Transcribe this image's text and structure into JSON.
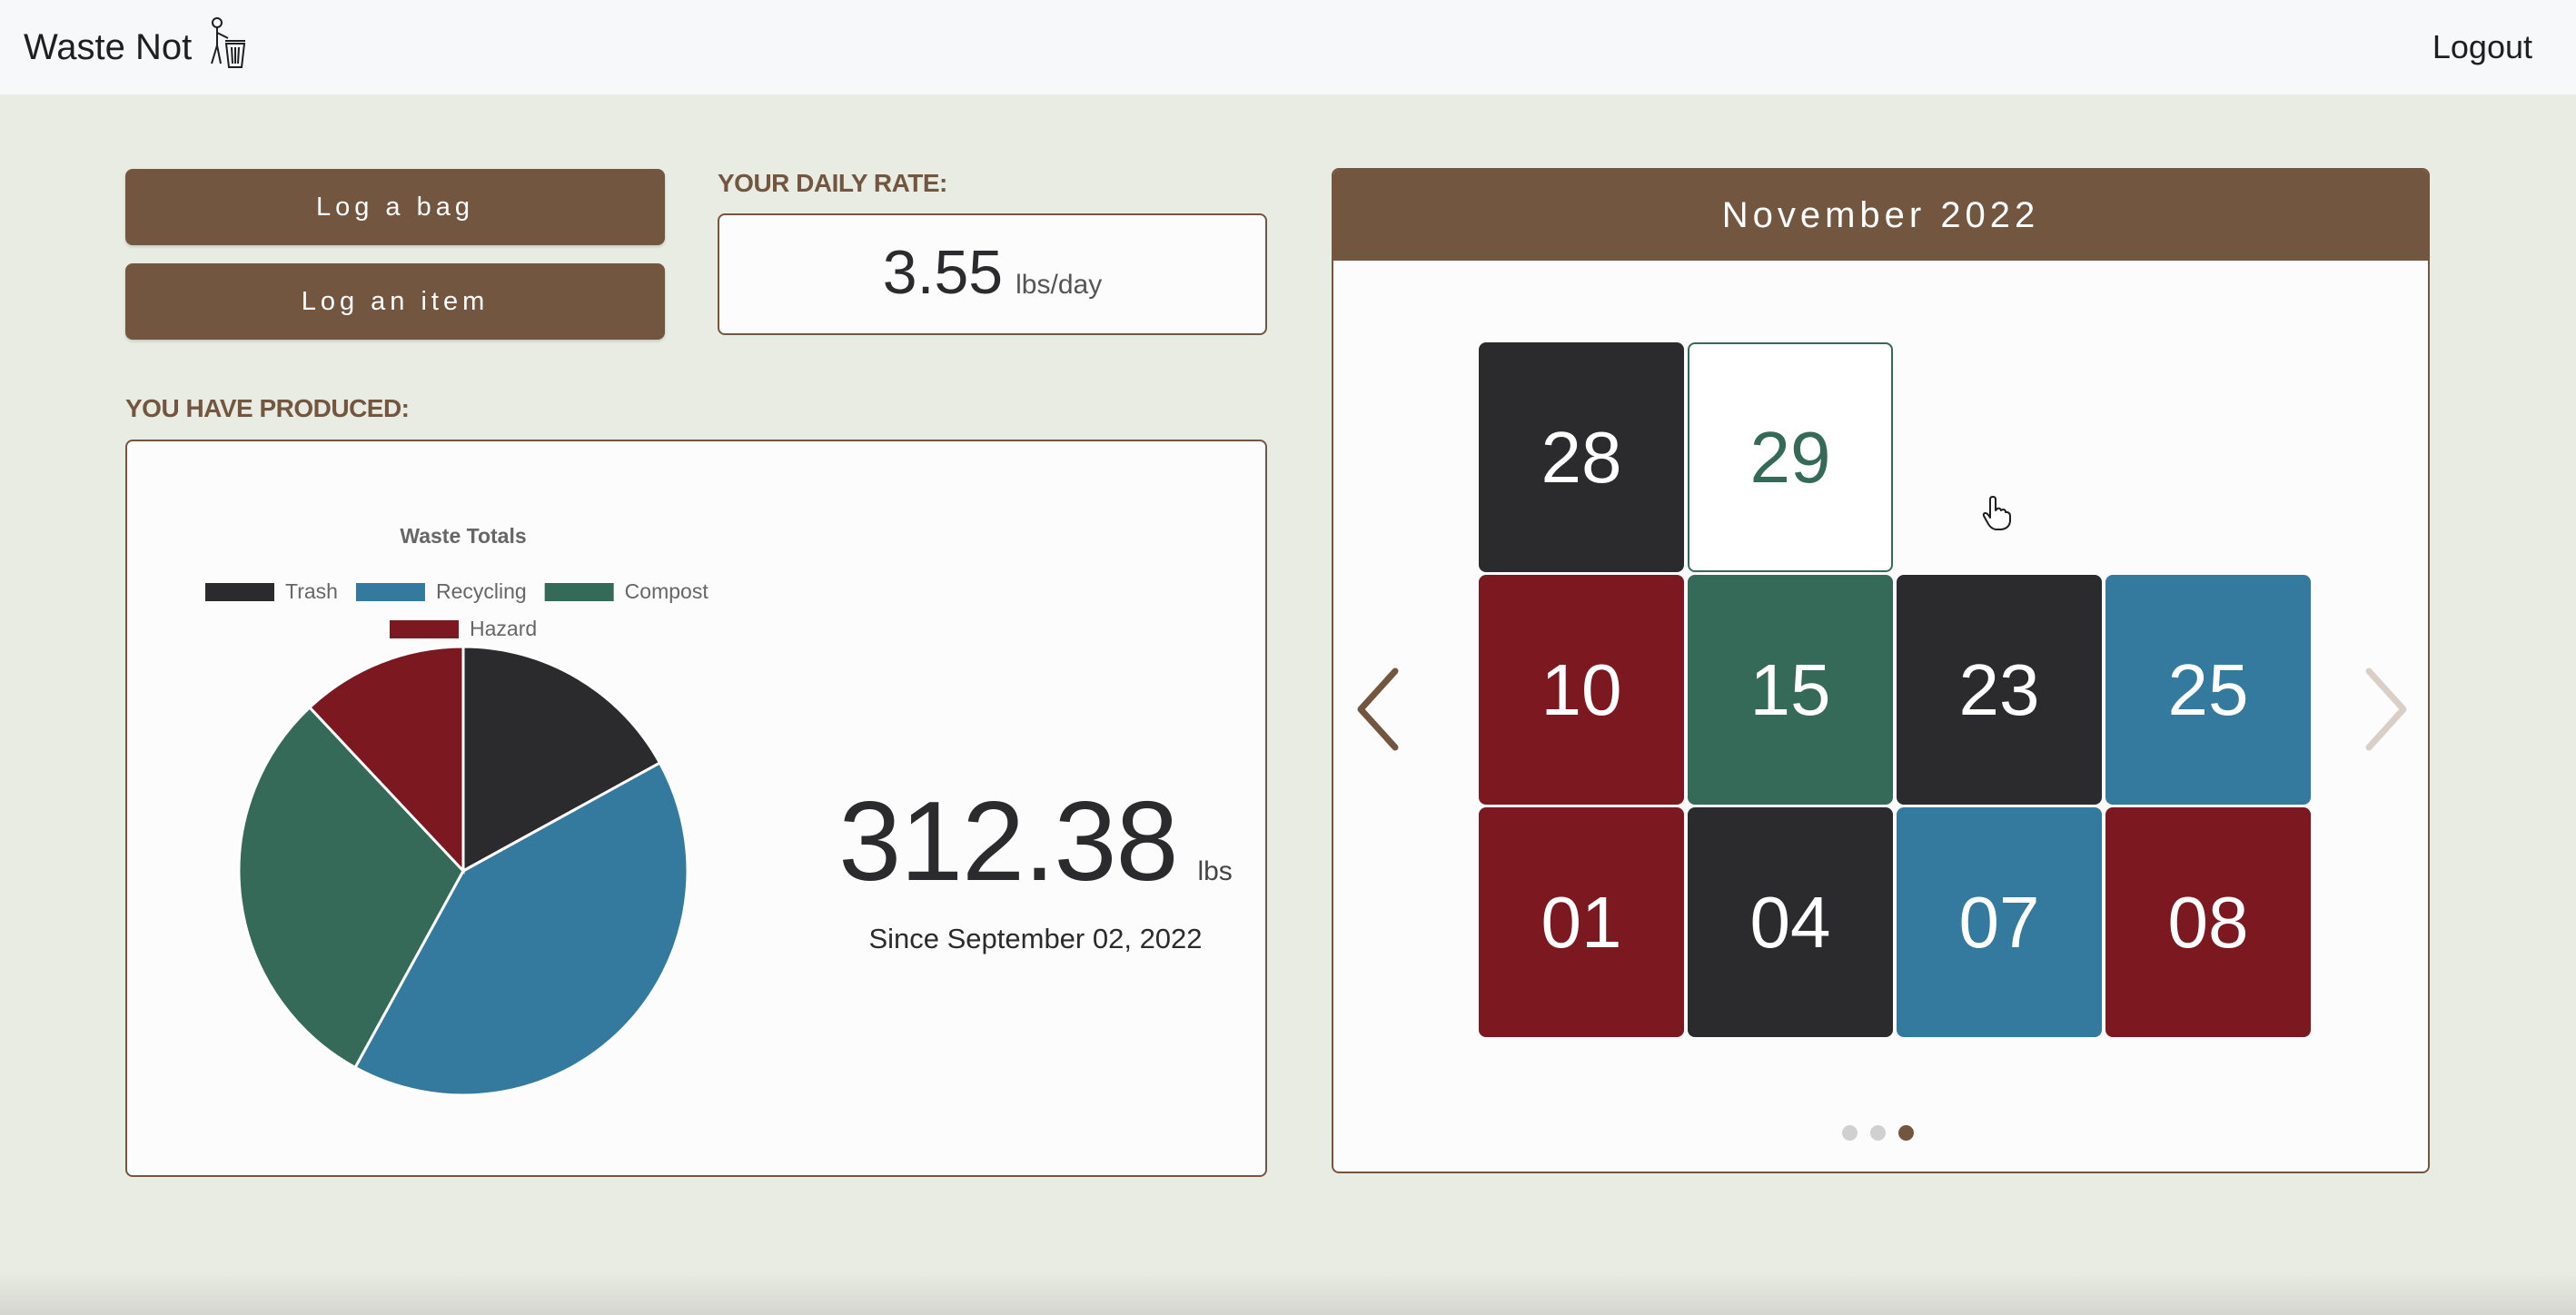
{
  "app": {
    "title": "Waste Not",
    "logout_label": "Logout"
  },
  "actions": {
    "log_bag_label": "Log a bag",
    "log_item_label": "Log an item"
  },
  "daily_rate": {
    "label": "YOUR DAILY RATE:",
    "value": "3.55",
    "unit": "lbs/day"
  },
  "produced": {
    "label": "YOU HAVE PRODUCED:",
    "total": "312.38",
    "unit": "lbs",
    "since": "Since September 02, 2022"
  },
  "chart_data": {
    "type": "pie",
    "title": "Waste Totals",
    "categories": [
      "Trash",
      "Recycling",
      "Compost",
      "Hazard"
    ],
    "values": [
      17,
      41,
      30,
      12
    ],
    "colors": [
      "#2b2b2d",
      "#347a9e",
      "#346a57",
      "#7c1820"
    ],
    "legend_position": "top"
  },
  "calendar": {
    "month_label": "November 2022",
    "tiles": [
      {
        "day": "29",
        "status": "selected"
      },
      {
        "day": "28",
        "color": "#2b2b2d"
      },
      {
        "day": "25",
        "color": "#347a9e"
      },
      {
        "day": "23",
        "color": "#2b2b2d"
      },
      {
        "day": "15",
        "color": "#346a57"
      },
      {
        "day": "10",
        "color": "#7c1820"
      },
      {
        "day": "08",
        "color": "#7c1820"
      },
      {
        "day": "07",
        "color": "#347a9e"
      },
      {
        "day": "04",
        "color": "#2b2b2d"
      },
      {
        "day": "01",
        "color": "#7c1820"
      }
    ],
    "pages": 3,
    "active_page": 3
  },
  "colors": {
    "brand_brown": "#73563f",
    "background": "#e9ece3",
    "navbar": "#f6f8fa"
  }
}
